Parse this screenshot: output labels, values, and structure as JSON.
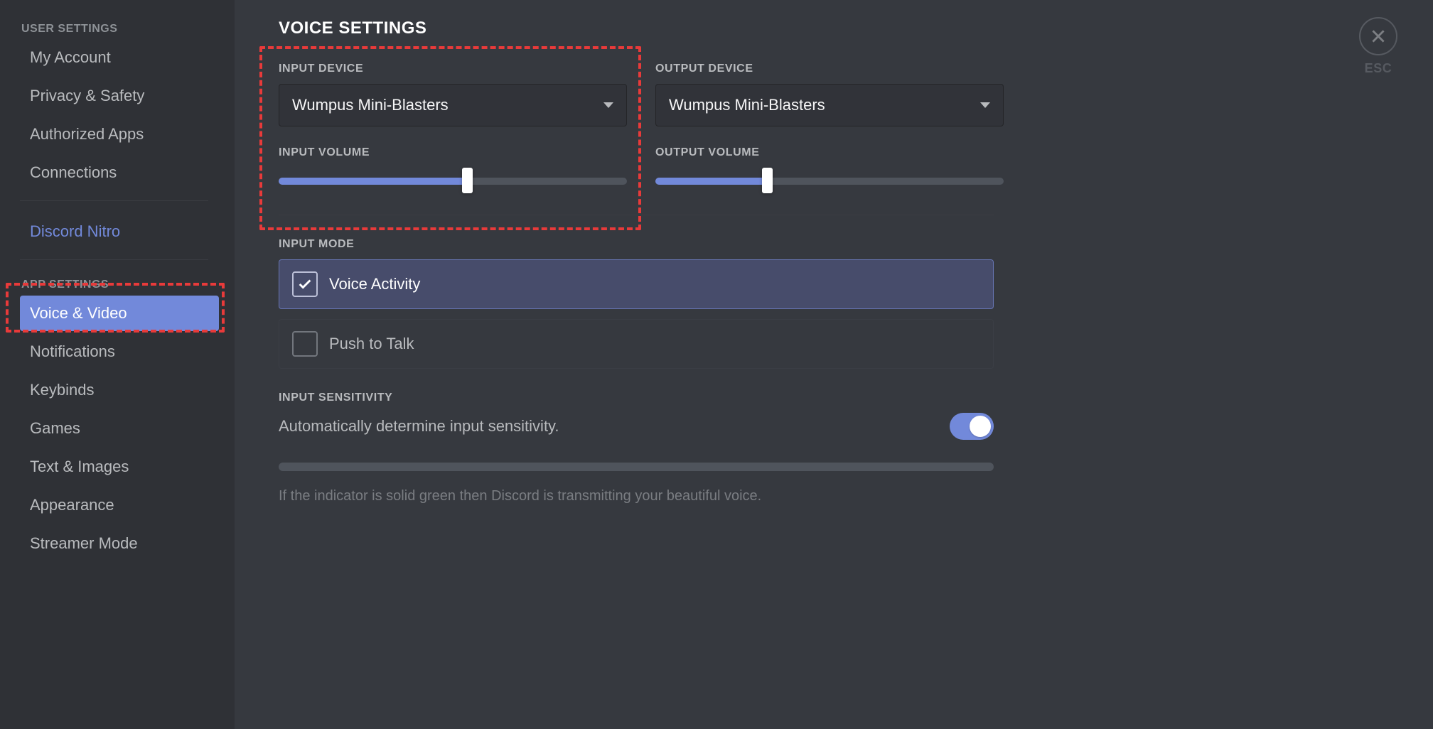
{
  "sidebar": {
    "section_user": "User Settings",
    "section_app": "App Settings",
    "items_user": [
      {
        "label": "My Account"
      },
      {
        "label": "Privacy & Safety"
      },
      {
        "label": "Authorized Apps"
      },
      {
        "label": "Connections"
      }
    ],
    "nitro": "Discord Nitro",
    "items_app": [
      {
        "label": "Voice & Video",
        "active": true
      },
      {
        "label": "Notifications"
      },
      {
        "label": "Keybinds"
      },
      {
        "label": "Games"
      },
      {
        "label": "Text & Images"
      },
      {
        "label": "Appearance"
      },
      {
        "label": "Streamer Mode"
      }
    ]
  },
  "content": {
    "title": "Voice Settings",
    "input_device": {
      "label": "Input Device",
      "value": "Wumpus Mini-Blasters"
    },
    "output_device": {
      "label": "Output Device",
      "value": "Wumpus Mini-Blasters"
    },
    "input_volume": {
      "label": "Input Volume",
      "percent": 54
    },
    "output_volume": {
      "label": "Output Volume",
      "percent": 32
    },
    "input_mode": {
      "label": "Input Mode",
      "voice_activity": "Voice Activity",
      "push_to_talk": "Push to Talk"
    },
    "input_sensitivity": {
      "label": "Input Sensitivity",
      "desc": "Automatically determine input sensitivity.",
      "helper": "If the indicator is solid green then Discord is transmitting your beautiful voice.",
      "enabled": true
    },
    "close": {
      "esc": "ESC"
    }
  }
}
